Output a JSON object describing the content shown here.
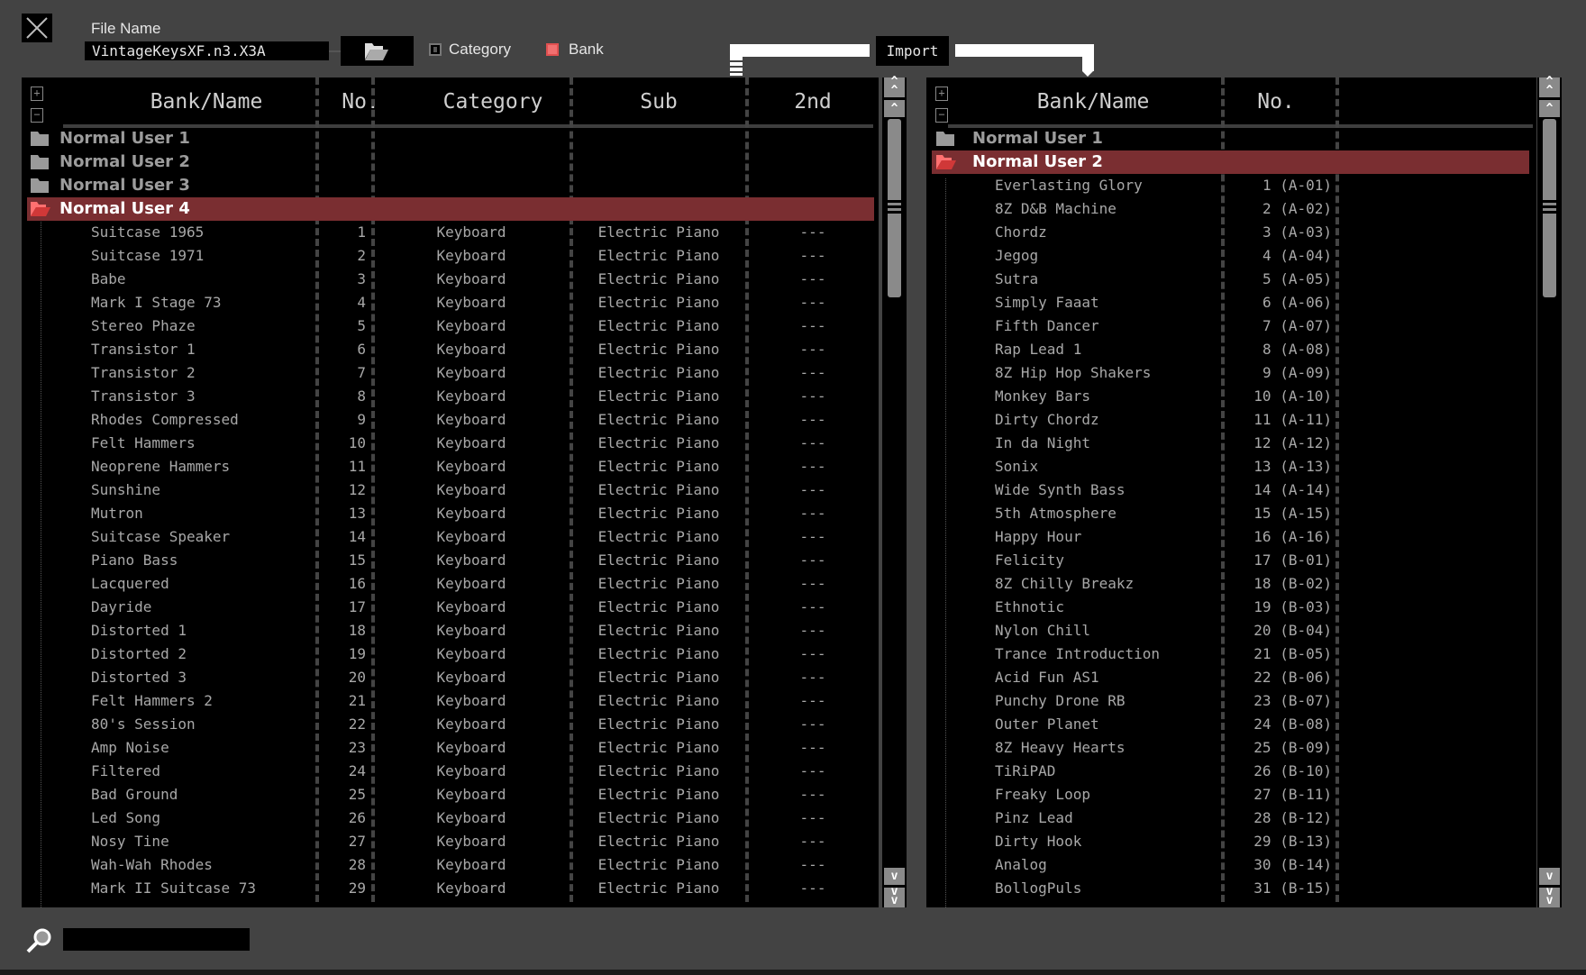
{
  "toolbar": {
    "close_icon": "close-x-icon",
    "file_name_label": "File Name",
    "file_name_value": "VintageKeysXF.n3.X3A",
    "open_folder_icon": "folder-open-icon",
    "category_label": "Category",
    "category_checked": false,
    "bank_label": "Bank",
    "bank_checked": true,
    "import_label": "Import"
  },
  "colors": {
    "background": "#434343",
    "selected_row": "#7a2e31",
    "bank_checkbox": "#f07070",
    "text": "#a8a8a8"
  },
  "left": {
    "headers": {
      "name": "Bank/Name",
      "no": "No.",
      "category": "Category",
      "sub": "Sub",
      "second": "2nd"
    },
    "folders": [
      {
        "name": "Normal User  1",
        "selected": false
      },
      {
        "name": "Normal User 2",
        "selected": false
      },
      {
        "name": "Normal User 3",
        "selected": false
      },
      {
        "name": "Normal User 4",
        "selected": true
      }
    ],
    "items": [
      [
        "Suitcase 1965",
        "1",
        "Keyboard",
        "Electric Piano",
        "---"
      ],
      [
        "Suitcase 1971",
        "2",
        "Keyboard",
        "Electric Piano",
        "---"
      ],
      [
        "Babe",
        "3",
        "Keyboard",
        "Electric Piano",
        "---"
      ],
      [
        "Mark I Stage 73",
        "4",
        "Keyboard",
        "Electric Piano",
        "---"
      ],
      [
        "Stereo Phaze",
        "5",
        "Keyboard",
        "Electric Piano",
        "---"
      ],
      [
        "Transistor 1",
        "6",
        "Keyboard",
        "Electric Piano",
        "---"
      ],
      [
        "Transistor 2",
        "7",
        "Keyboard",
        "Electric Piano",
        "---"
      ],
      [
        "Transistor 3",
        "8",
        "Keyboard",
        "Electric Piano",
        "---"
      ],
      [
        "Rhodes Compressed",
        "9",
        "Keyboard",
        "Electric Piano",
        "---"
      ],
      [
        "Felt Hammers",
        "10",
        "Keyboard",
        "Electric Piano",
        "---"
      ],
      [
        "Neoprene Hammers",
        "11",
        "Keyboard",
        "Electric Piano",
        "---"
      ],
      [
        "Sunshine",
        "12",
        "Keyboard",
        "Electric Piano",
        "---"
      ],
      [
        "Mutron",
        "13",
        "Keyboard",
        "Electric Piano",
        "---"
      ],
      [
        "Suitcase Speaker",
        "14",
        "Keyboard",
        "Electric Piano",
        "---"
      ],
      [
        "Piano Bass",
        "15",
        "Keyboard",
        "Electric Piano",
        "---"
      ],
      [
        "Lacquered",
        "16",
        "Keyboard",
        "Electric Piano",
        "---"
      ],
      [
        "Dayride",
        "17",
        "Keyboard",
        "Electric Piano",
        "---"
      ],
      [
        "Distorted 1",
        "18",
        "Keyboard",
        "Electric Piano",
        "---"
      ],
      [
        "Distorted 2",
        "19",
        "Keyboard",
        "Electric Piano",
        "---"
      ],
      [
        "Distorted 3",
        "20",
        "Keyboard",
        "Electric Piano",
        "---"
      ],
      [
        "Felt Hammers 2",
        "21",
        "Keyboard",
        "Electric Piano",
        "---"
      ],
      [
        "80's Session",
        "22",
        "Keyboard",
        "Electric Piano",
        "---"
      ],
      [
        "Amp Noise",
        "23",
        "Keyboard",
        "Electric Piano",
        "---"
      ],
      [
        "Filtered",
        "24",
        "Keyboard",
        "Electric Piano",
        "---"
      ],
      [
        "Bad Ground",
        "25",
        "Keyboard",
        "Electric Piano",
        "---"
      ],
      [
        "Led Song",
        "26",
        "Keyboard",
        "Electric Piano",
        "---"
      ],
      [
        "Nosy Tine",
        "27",
        "Keyboard",
        "Electric Piano",
        "---"
      ],
      [
        "Wah-Wah Rhodes",
        "28",
        "Keyboard",
        "Electric Piano",
        "---"
      ],
      [
        "Mark II Suitcase 73",
        "29",
        "Keyboard",
        "Electric Piano",
        "---"
      ]
    ]
  },
  "right": {
    "headers": {
      "name": "Bank/Name",
      "no": "No."
    },
    "folders": [
      {
        "name": "Normal User  1",
        "selected": false
      },
      {
        "name": "Normal User 2",
        "selected": true
      }
    ],
    "items": [
      [
        "Everlasting Glory",
        "1 (A-01)"
      ],
      [
        "8Z D&B Machine",
        "2 (A-02)"
      ],
      [
        "Chordz",
        "3 (A-03)"
      ],
      [
        "Jegog",
        "4 (A-04)"
      ],
      [
        "Sutra",
        "5 (A-05)"
      ],
      [
        "Simply Faaat",
        "6 (A-06)"
      ],
      [
        "Fifth Dancer",
        "7 (A-07)"
      ],
      [
        "Rap Lead 1",
        "8 (A-08)"
      ],
      [
        "8Z Hip Hop Shakers",
        "9 (A-09)"
      ],
      [
        "Monkey Bars",
        "10 (A-10)"
      ],
      [
        "Dirty Chordz",
        "11 (A-11)"
      ],
      [
        "In da Night",
        "12 (A-12)"
      ],
      [
        "Sonix",
        "13 (A-13)"
      ],
      [
        "Wide Synth Bass",
        "14 (A-14)"
      ],
      [
        "5th Atmosphere",
        "15 (A-15)"
      ],
      [
        "Happy Hour",
        "16 (A-16)"
      ],
      [
        "Felicity",
        "17 (B-01)"
      ],
      [
        "8Z Chilly Breakz",
        "18 (B-02)"
      ],
      [
        "Ethnotic",
        "19 (B-03)"
      ],
      [
        "Nylon Chill",
        "20 (B-04)"
      ],
      [
        "Trance Introduction",
        "21 (B-05)"
      ],
      [
        "Acid Fun AS1",
        "22 (B-06)"
      ],
      [
        "Punchy Drone RB",
        "23 (B-07)"
      ],
      [
        "Outer Planet",
        "24 (B-08)"
      ],
      [
        "8Z Heavy Hearts",
        "25 (B-09)"
      ],
      [
        "TiRiPAD",
        "26 (B-10)"
      ],
      [
        "Freaky Loop",
        "27 (B-11)"
      ],
      [
        "Pinz Lead",
        "28 (B-12)"
      ],
      [
        "Dirty Hook",
        "29 (B-13)"
      ],
      [
        "Analog",
        "30 (B-14)"
      ],
      [
        "BollogPuls",
        "31 (B-15)"
      ]
    ]
  },
  "search": {
    "value": "",
    "icon": "magnifier-icon"
  }
}
